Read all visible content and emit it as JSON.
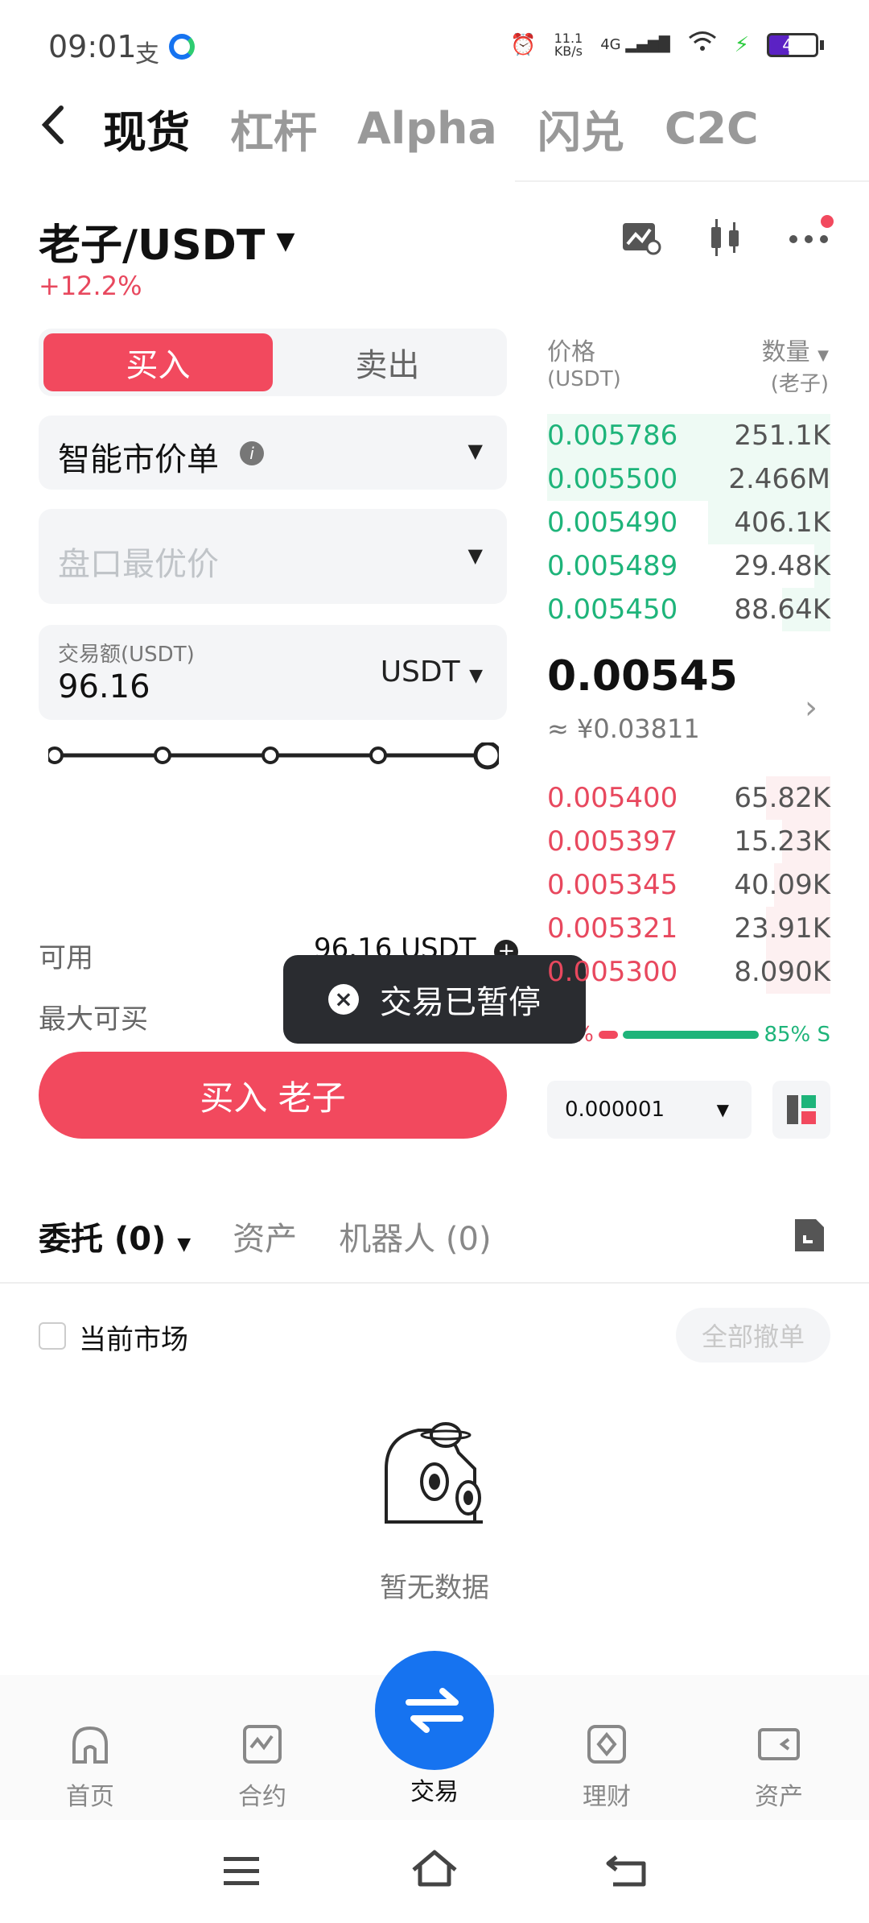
{
  "status": {
    "time": "09:01",
    "speed": "11.1",
    "speed_unit": "KB/s",
    "network": "4G",
    "battery": "41"
  },
  "tabs": [
    "现货",
    "杠杆",
    "Alpha",
    "闪兑",
    "C2C"
  ],
  "pair": {
    "name": "老子/USDT",
    "change": "+12.2%"
  },
  "order_form": {
    "buy_label": "买入",
    "sell_label": "卖出",
    "order_type": "智能市价单",
    "price_placeholder": "盘口最优价",
    "amount_label": "交易额(USDT)",
    "amount_value": "96.16",
    "amount_unit": "USDT",
    "slider_level": 1.0,
    "available_label": "可用",
    "available_value": "96.16 USDT",
    "max_buy_label": "最大可买",
    "submit_label": "买入 老子"
  },
  "order_book": {
    "price_header": "价格",
    "price_unit": "(USDT)",
    "qty_header": "数量",
    "qty_unit": "(老子)",
    "asks": [
      {
        "price": "0.005786",
        "qty": "251.1K"
      },
      {
        "price": "0.005500",
        "qty": "2.466M"
      },
      {
        "price": "0.005490",
        "qty": "406.1K"
      },
      {
        "price": "0.005489",
        "qty": "29.48K"
      },
      {
        "price": "0.005450",
        "qty": "88.64K"
      }
    ],
    "mid_price": "0.00545",
    "mid_fiat": "≈ ¥0.03811",
    "bids": [
      {
        "price": "0.005400",
        "qty": "65.82K"
      },
      {
        "price": "0.005397",
        "qty": "15.23K"
      },
      {
        "price": "0.005345",
        "qty": "40.09K"
      },
      {
        "price": "0.005321",
        "qty": "23.91K"
      },
      {
        "price": "0.005300",
        "qty": "8.090K"
      }
    ],
    "buy_ratio": "15%",
    "sell_ratio": "85% S",
    "precision": "0.000001"
  },
  "toast": "交易已暂停",
  "orders": {
    "tab_orders": "委托 (0)",
    "tab_assets": "资产",
    "tab_bots": "机器人 (0)",
    "current_market": "当前市场",
    "cancel_all": "全部撤单",
    "empty": "暂无数据"
  },
  "nav": [
    "首页",
    "合约",
    "交易",
    "理财",
    "资产"
  ],
  "colors": {
    "buy": "#f2495e",
    "sell_green": "#1eb47a",
    "accent": "#1673f0"
  }
}
